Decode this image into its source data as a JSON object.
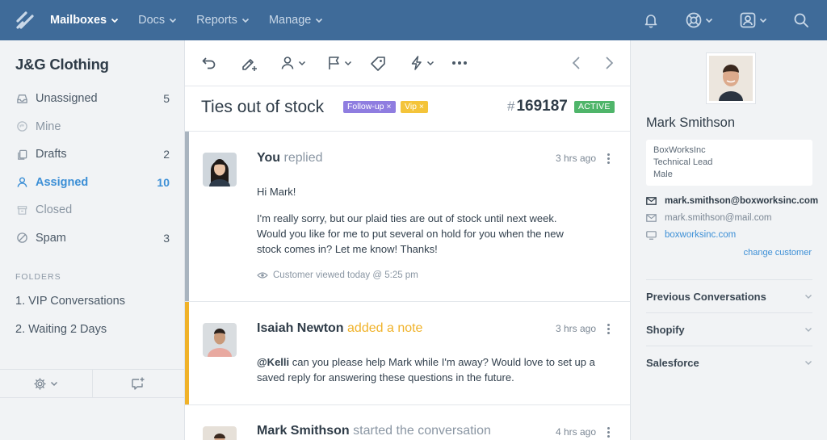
{
  "nav": {
    "items": [
      {
        "label": "Mailboxes",
        "active": true
      },
      {
        "label": "Docs"
      },
      {
        "label": "Reports"
      },
      {
        "label": "Manage"
      }
    ]
  },
  "sidebar": {
    "mailbox_name": "J&G Clothing",
    "folders": [
      {
        "label": "Unassigned",
        "count": "5",
        "icon": "inbox-icon"
      },
      {
        "label": "Mine",
        "count": "",
        "icon": "hand-icon"
      },
      {
        "label": "Drafts",
        "count": "2",
        "icon": "drafts-icon"
      },
      {
        "label": "Assigned",
        "count": "10",
        "icon": "person-icon"
      },
      {
        "label": "Closed",
        "count": "",
        "icon": "archive-icon"
      },
      {
        "label": "Spam",
        "count": "3",
        "icon": "spam-icon"
      }
    ],
    "folders_heading": "FOLDERS",
    "custom_folders": [
      "1. VIP Conversations",
      "2. Waiting 2 Days"
    ]
  },
  "conversation": {
    "subject": "Ties out of stock",
    "tags": [
      "Follow-up ×",
      "Vip ×"
    ],
    "number": "169187",
    "hash": "#",
    "status": "ACTIVE",
    "threads": [
      {
        "author": "You",
        "action": "replied",
        "time": "3 hrs ago",
        "lines": [
          "Hi Mark!",
          "I'm really sorry, but our plaid ties are out of stock until next week. Would you like for me to put several on hold for you when the new stock comes in? Let me know! Thanks!"
        ],
        "viewed": "Customer viewed today @ 5:25 pm"
      },
      {
        "author": "Isaiah Newton",
        "action": "added a note",
        "time": "3 hrs ago",
        "mention": "@Kelli",
        "text": " can you please help Mark while I'm away? Would love to set up a saved reply for answering these questions in the future."
      },
      {
        "author": "Mark Smithson",
        "action": "started the conversation",
        "time": "4 hrs ago"
      }
    ]
  },
  "customer": {
    "name": "Mark Smithson",
    "company": "BoxWorksInc",
    "title": "Technical Lead",
    "gender": "Male",
    "emails": [
      "mark.smithson@boxworksinc.com",
      "mark.smithson@mail.com"
    ],
    "website": "boxworksinc.com",
    "change_label": "change customer",
    "sections": [
      "Previous Conversations",
      "Shopify",
      "Salesforce"
    ]
  },
  "colors": {
    "nav_bg": "#3f6b99",
    "accent": "#3c8fd6",
    "note": "#f0b229",
    "active_badge": "#4fb56a",
    "followup_tag": "#8f7de0",
    "vip_tag": "#f4c43a"
  }
}
